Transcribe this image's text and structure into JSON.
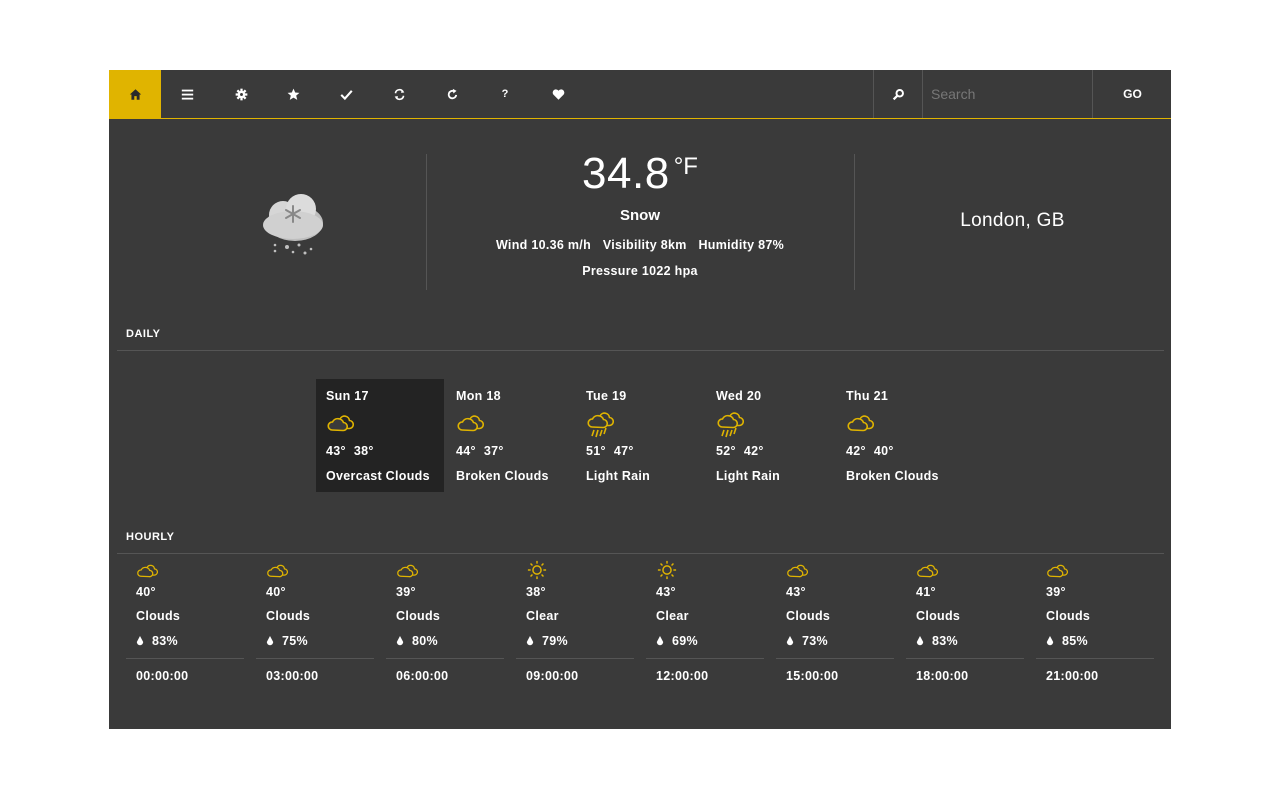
{
  "nav": {
    "items": [
      {
        "icon": "home-icon"
      },
      {
        "icon": "menu-icon"
      },
      {
        "icon": "gear-icon"
      },
      {
        "icon": "star-icon"
      },
      {
        "icon": "check-icon"
      },
      {
        "icon": "refresh-icon"
      },
      {
        "icon": "reload-icon"
      },
      {
        "icon": "help-icon",
        "glyph": "?"
      },
      {
        "icon": "heart-icon"
      }
    ],
    "search_placeholder": "Search",
    "go_label": "GO"
  },
  "current": {
    "icon": "night-snow-icon",
    "temp": "34.8",
    "unit": "°F",
    "condition": "Snow",
    "wind": "Wind 10.36 m/h",
    "visibility": "Visibility 8km",
    "humidity": "Humidity 87%",
    "pressure": "Pressure 1022 hpa",
    "location": "London, GB"
  },
  "daily": {
    "title": "DAILY",
    "days": [
      {
        "name": "Sun 17",
        "icon": "clouds-icon",
        "high": "43°",
        "low": "38°",
        "desc": "Overcast Clouds",
        "selected": true
      },
      {
        "name": "Mon 18",
        "icon": "clouds-icon",
        "high": "44°",
        "low": "37°",
        "desc": "Broken Clouds",
        "selected": false
      },
      {
        "name": "Tue 19",
        "icon": "rain-icon",
        "high": "51°",
        "low": "47°",
        "desc": "Light Rain",
        "selected": false
      },
      {
        "name": "Wed 20",
        "icon": "rain-icon",
        "high": "52°",
        "low": "42°",
        "desc": "Light Rain",
        "selected": false
      },
      {
        "name": "Thu 21",
        "icon": "clouds-icon",
        "high": "42°",
        "low": "40°",
        "desc": "Broken Clouds",
        "selected": false
      }
    ]
  },
  "hourly": {
    "title": "HOURLY",
    "hours": [
      {
        "icon": "clouds-icon",
        "temp": "40°",
        "desc": "Clouds",
        "humidity": "83%",
        "time": "00:00:00"
      },
      {
        "icon": "clouds-icon",
        "temp": "40°",
        "desc": "Clouds",
        "humidity": "75%",
        "time": "03:00:00"
      },
      {
        "icon": "clouds-icon",
        "temp": "39°",
        "desc": "Clouds",
        "humidity": "80%",
        "time": "06:00:00"
      },
      {
        "icon": "sun-icon",
        "temp": "38°",
        "desc": "Clear",
        "humidity": "79%",
        "time": "09:00:00"
      },
      {
        "icon": "sun-icon",
        "temp": "43°",
        "desc": "Clear",
        "humidity": "69%",
        "time": "12:00:00"
      },
      {
        "icon": "clouds-icon",
        "temp": "43°",
        "desc": "Clouds",
        "humidity": "73%",
        "time": "15:00:00"
      },
      {
        "icon": "clouds-icon",
        "temp": "41°",
        "desc": "Clouds",
        "humidity": "83%",
        "time": "18:00:00"
      },
      {
        "icon": "clouds-icon",
        "temp": "39°",
        "desc": "Clouds",
        "humidity": "85%",
        "time": "21:00:00"
      }
    ]
  },
  "colors": {
    "accent": "#e0b400",
    "background": "#3a3a3a",
    "selected": "#232323"
  }
}
